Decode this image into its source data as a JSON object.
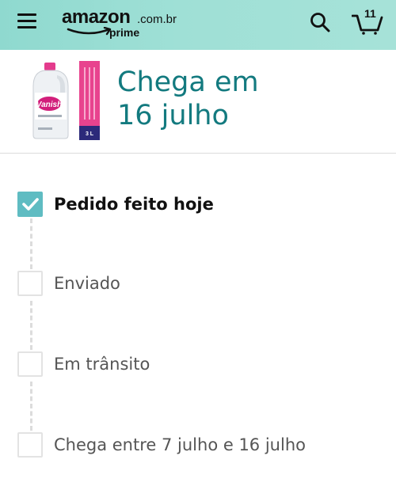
{
  "header": {
    "logo_word": "amazon",
    "logo_tld": ".com.br",
    "logo_prime": "prime",
    "cart_count": "11"
  },
  "summary": {
    "arrival_line1": "Chega em",
    "arrival_line2": "16 julho",
    "product_label_brand": "Vanish",
    "product_label_volume": "3 L",
    "product_label_box_text": "TIRA MANCHAS EM GEL PARA ROUPAS BRANCAS"
  },
  "tracker": {
    "steps": [
      {
        "label": "Pedido feito hoje",
        "done": true
      },
      {
        "label": "Enviado",
        "done": false
      },
      {
        "label": "Em trânsito",
        "done": false
      },
      {
        "label": "Chega entre 7 julho e 16 julho",
        "done": false
      }
    ]
  },
  "colors": {
    "accent": "#137a7f",
    "check": "#5fbcc2",
    "header_bg": "#9fe0d6"
  }
}
